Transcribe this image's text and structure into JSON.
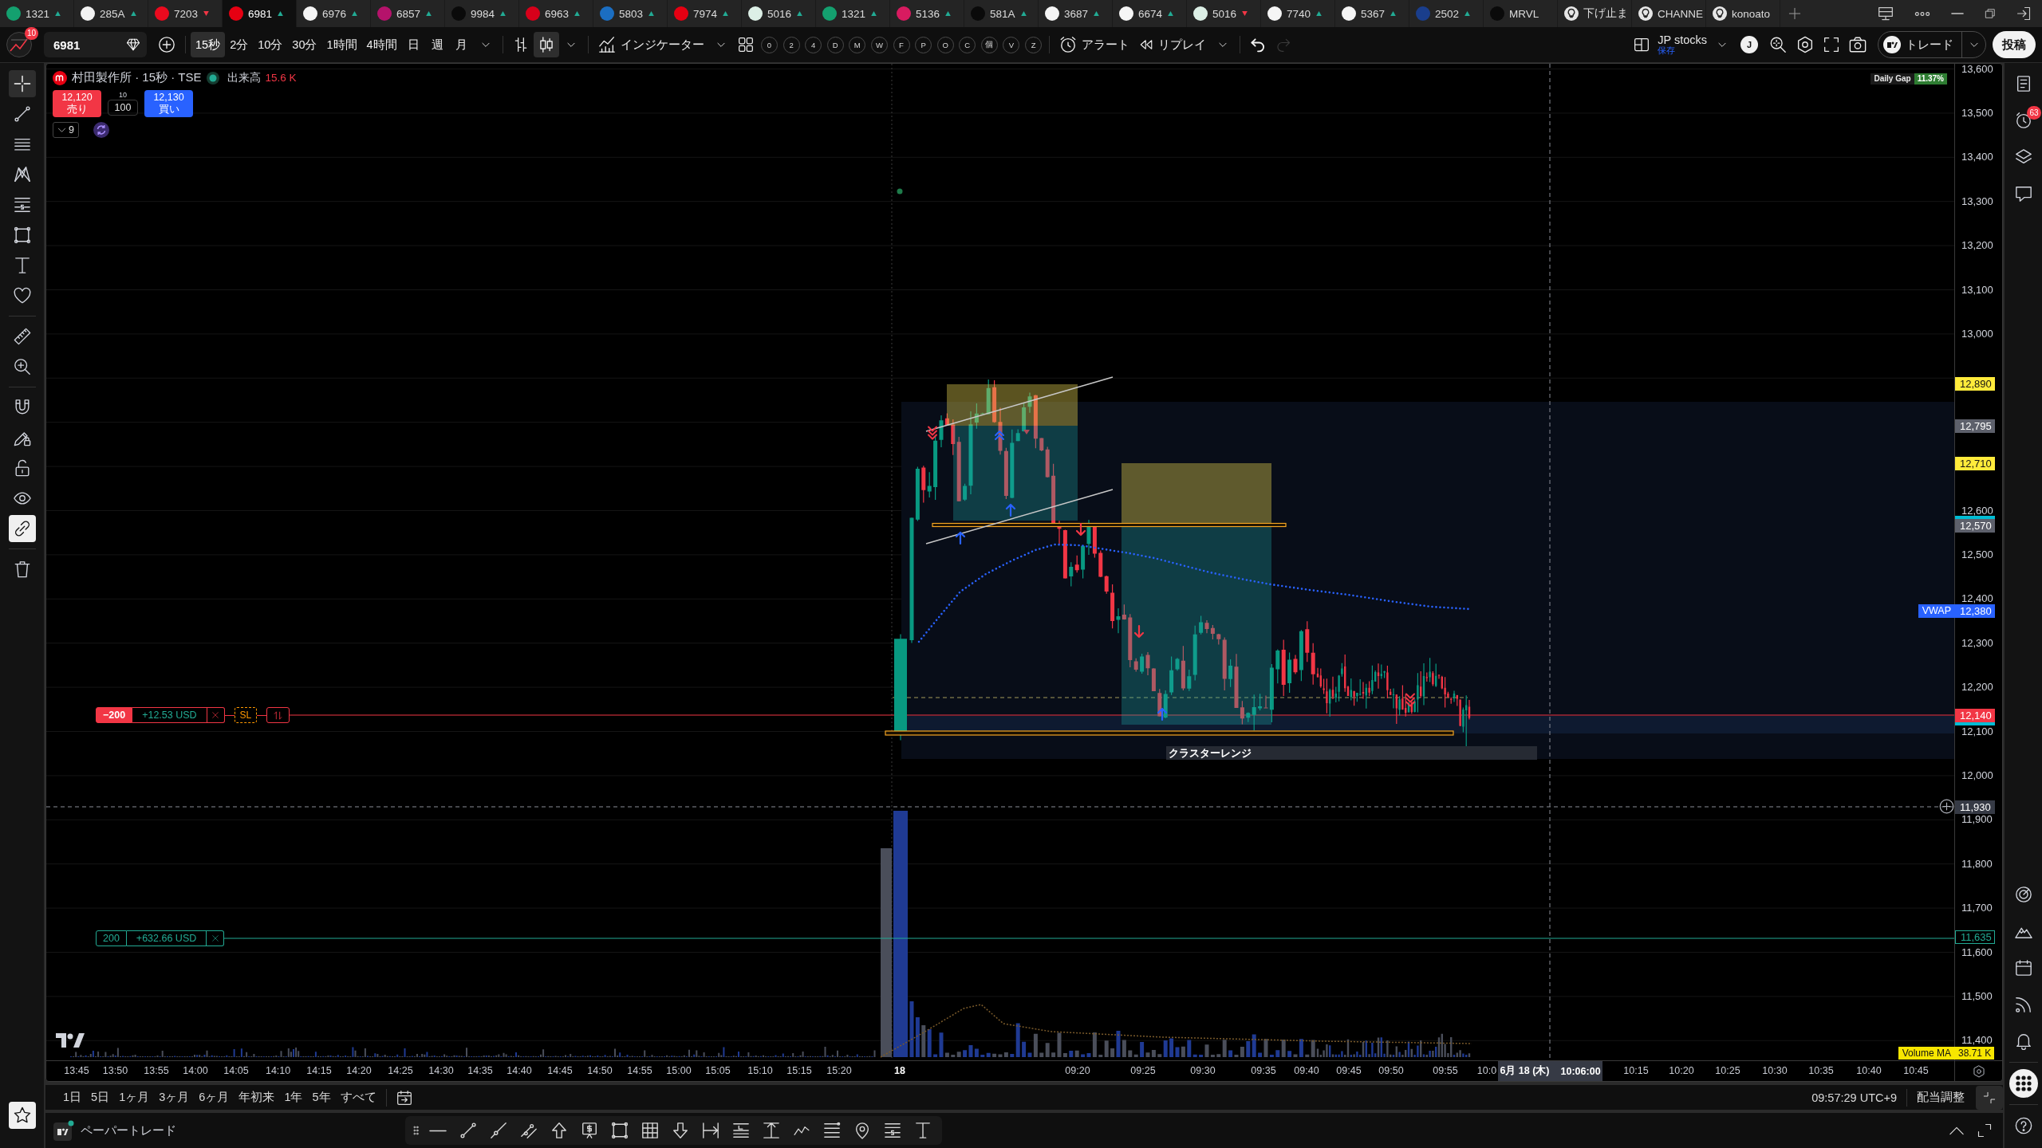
{
  "tabs": [
    {
      "kind": "symbol",
      "label": "1321",
      "up": true,
      "color": "#14a06f",
      "selected": false
    },
    {
      "kind": "symbol",
      "label": "285A",
      "up": true,
      "color": "#f2f2f2",
      "selected": false
    },
    {
      "kind": "symbol",
      "label": "7203",
      "up": false,
      "color": "#eb0a1e",
      "selected": false
    },
    {
      "kind": "symbol",
      "label": "6981",
      "up": true,
      "color": "#e60012",
      "selected": true
    },
    {
      "kind": "symbol",
      "label": "6976",
      "up": true,
      "color": "#f5f5f5",
      "selected": false
    },
    {
      "kind": "symbol",
      "label": "6857",
      "up": true,
      "color": "#b5136b",
      "selected": false
    },
    {
      "kind": "symbol",
      "label": "9984",
      "up": true,
      "color": "#0a0a0a",
      "selected": false
    },
    {
      "kind": "symbol",
      "label": "6963",
      "up": true,
      "color": "#d7001a",
      "selected": false
    },
    {
      "kind": "symbol",
      "label": "5803",
      "up": true,
      "color": "#1b6ec2",
      "selected": false
    },
    {
      "kind": "symbol",
      "label": "7974",
      "up": true,
      "color": "#e60012",
      "selected": false
    },
    {
      "kind": "symbol",
      "label": "5016",
      "up": true,
      "color": "#dcefe6",
      "selected": false
    },
    {
      "kind": "symbol",
      "label": "1321",
      "up": true,
      "color": "#14a06f",
      "selected": false
    },
    {
      "kind": "symbol",
      "label": "5136",
      "up": true,
      "color": "#d81b60",
      "selected": false
    },
    {
      "kind": "symbol",
      "label": "581A",
      "up": true,
      "color": "#0a0a0a",
      "selected": false
    },
    {
      "kind": "symbol",
      "label": "3687",
      "up": true,
      "color": "#f5f5f5",
      "selected": false
    },
    {
      "kind": "symbol",
      "label": "6674",
      "up": true,
      "color": "#f5f5f5",
      "selected": false
    },
    {
      "kind": "symbol",
      "label": "5016",
      "up": false,
      "color": "#dcefe6",
      "selected": false
    },
    {
      "kind": "symbol",
      "label": "7740",
      "up": true,
      "color": "#f5f5f5",
      "selected": false
    },
    {
      "kind": "symbol",
      "label": "5367",
      "up": true,
      "color": "#f5f5f5",
      "selected": false
    },
    {
      "kind": "symbol",
      "label": "2502",
      "up": true,
      "color": "#1a3e8c",
      "selected": false
    },
    {
      "kind": "symbol",
      "label": "MRVL",
      "color": "#0a0a0a",
      "selected": false
    },
    {
      "kind": "idea",
      "label": "下げ止ま",
      "selected": false
    },
    {
      "kind": "idea",
      "label": "CHANNE",
      "selected": false
    },
    {
      "kind": "idea",
      "label": "konoato",
      "selected": false
    }
  ],
  "toolbar": {
    "notification_count": "10",
    "symbol": "6981",
    "intervals": [
      {
        "label": "15秒",
        "selected": true
      },
      {
        "label": "2分",
        "selected": false
      },
      {
        "label": "10分",
        "selected": false
      },
      {
        "label": "30分",
        "selected": false
      },
      {
        "label": "1時間",
        "selected": false
      },
      {
        "label": "4時間",
        "selected": false
      },
      {
        "label": "日",
        "selected": false
      },
      {
        "label": "週",
        "selected": false
      },
      {
        "label": "月",
        "selected": false
      }
    ],
    "chart_styles": [
      {
        "kind": "bars",
        "selected": false
      },
      {
        "kind": "candles",
        "selected": true
      }
    ],
    "indicators_label": "インジケーター",
    "quick_buttons": [
      "0",
      "2",
      "4",
      "D",
      "M",
      "W",
      "F",
      "P",
      "O",
      "C",
      "個",
      "V",
      "Z"
    ],
    "alert_label": "アラート",
    "replay_label": "リプレイ",
    "history": [
      {
        "kind": "undo",
        "disabled": false
      },
      {
        "kind": "redo",
        "disabled": true
      }
    ],
    "layout_name": "JP stocks",
    "layout_status": "保存",
    "user_initial": "J",
    "trade_label": "トレード",
    "publish_label": "投稿"
  },
  "left_toolbar": [
    {
      "kind": "crosshair",
      "selected": true
    },
    {
      "kind": "trendline",
      "selected": false
    },
    {
      "kind": "fibonacci",
      "selected": false
    },
    {
      "kind": "pattern",
      "selected": false
    },
    {
      "kind": "forecast",
      "selected": false
    },
    {
      "kind": "shapes",
      "selected": false
    },
    {
      "kind": "text",
      "selected": false
    },
    {
      "kind": "favorites",
      "selected": false
    },
    {
      "kind": "measure",
      "selected": false
    },
    {
      "kind": "zoom",
      "selected": false
    },
    {
      "kind": "magnet",
      "selected": false
    },
    {
      "kind": "drawing-lock",
      "selected": false
    },
    {
      "kind": "lock",
      "selected": false
    },
    {
      "kind": "visibility",
      "selected": false
    },
    {
      "kind": "sync",
      "selected": true
    },
    {
      "kind": "remove",
      "selected": false
    }
  ],
  "chart": {
    "legend": {
      "title": "村田製作所 · 15秒 · TSE",
      "volume_label": "出来高",
      "volume_value": "15.6 K",
      "sell_price": "12,120",
      "sell_label": "売り",
      "spread": "10",
      "quantity": "100",
      "buy_price": "12,130",
      "buy_label": "買い",
      "collapsed_count": "9"
    },
    "daily_gap": {
      "label": "Daily Gap",
      "value": "11.37%"
    },
    "orders": [
      {
        "kind": "position",
        "quantity": "−200",
        "pnl": "+12.53 USD",
        "stop_label": "SL"
      },
      {
        "kind": "take_profit",
        "quantity": "200",
        "pnl": "+632.66 USD"
      }
    ],
    "drawing_label": "クラスターレンジ",
    "price_axis": {
      "ticks": [
        "13,600",
        "13,500",
        "13,400",
        "13,300",
        "13,200",
        "13,100",
        "13,000",
        "12,600",
        "12,500",
        "12,400",
        "12,300",
        "12,200",
        "12,100",
        "12,000",
        "11,900",
        "11,800",
        "11,700",
        "11,600",
        "11,500",
        "11,400"
      ],
      "markers": [
        {
          "kind": "filled",
          "label": "12,890",
          "color": "#ffeb3b"
        },
        {
          "kind": "filled",
          "label": "12,795",
          "color": "#5d606b"
        },
        {
          "kind": "filled",
          "label": "12,710",
          "color": "#ffeb3b"
        },
        {
          "kind": "edge",
          "color": "#00bcd4"
        },
        {
          "kind": "filled",
          "label": "12,570",
          "color": "#5d606b"
        },
        {
          "kind": "filled",
          "label": "12,380",
          "title": "VWAP",
          "color": "#2962ff"
        },
        {
          "kind": "filled",
          "label": "12,140",
          "color": "#f23645"
        },
        {
          "kind": "edge",
          "color": "#00bcd4"
        },
        {
          "kind": "outline",
          "label": "11,635",
          "color": "#22ab94"
        }
      ],
      "crosshair_price": "11,930",
      "volume_ma": {
        "label": "Volume MA",
        "value": "38.71 K"
      }
    },
    "time_axis": {
      "ticks": [
        {
          "kind": "time",
          "label": "13:45"
        },
        {
          "kind": "time",
          "label": "13:50"
        },
        {
          "kind": "time",
          "label": "13:55"
        },
        {
          "kind": "time",
          "label": "14:00"
        },
        {
          "kind": "time",
          "label": "14:05"
        },
        {
          "kind": "time",
          "label": "14:10"
        },
        {
          "kind": "time",
          "label": "14:15"
        },
        {
          "kind": "time",
          "label": "14:20"
        },
        {
          "kind": "time",
          "label": "14:25"
        },
        {
          "kind": "time",
          "label": "14:30"
        },
        {
          "kind": "time",
          "label": "14:35"
        },
        {
          "kind": "time",
          "label": "14:40"
        },
        {
          "kind": "time",
          "label": "14:45"
        },
        {
          "kind": "time",
          "label": "14:50"
        },
        {
          "kind": "time",
          "label": "14:55"
        },
        {
          "kind": "time",
          "label": "15:00"
        },
        {
          "kind": "time",
          "label": "15:05"
        },
        {
          "kind": "time",
          "label": "15:10"
        },
        {
          "kind": "time",
          "label": "15:15"
        },
        {
          "kind": "time",
          "label": "15:20"
        },
        {
          "kind": "day",
          "label": "18"
        },
        {
          "kind": "time",
          "label": "09:20"
        },
        {
          "kind": "time",
          "label": "09:25"
        },
        {
          "kind": "time",
          "label": "09:30"
        },
        {
          "kind": "time",
          "label": "09:35"
        },
        {
          "kind": "time",
          "label": "09:40"
        },
        {
          "kind": "time",
          "label": "09:45"
        },
        {
          "kind": "time",
          "label": "09:50"
        },
        {
          "kind": "time",
          "label": "09:55"
        },
        {
          "kind": "time",
          "label": "10:0"
        },
        {
          "kind": "time",
          "label": "10:15"
        },
        {
          "kind": "time",
          "label": "10:20"
        },
        {
          "kind": "time",
          "label": "10:25"
        },
        {
          "kind": "time",
          "label": "10:30"
        },
        {
          "kind": "time",
          "label": "10:35"
        },
        {
          "kind": "time",
          "label": "10:40"
        },
        {
          "kind": "time",
          "label": "10:45"
        }
      ],
      "crosshair_date": "6月 18 (木)",
      "crosshair_time": "10:06:00"
    }
  },
  "range_bar": {
    "ranges": [
      "1日",
      "5日",
      "1ヶ月",
      "3ヶ月",
      "6ヶ月",
      "年初来",
      "1年",
      "5年",
      "すべて"
    ],
    "clock": "09:57:29 UTC+9",
    "adjustment_label": "配当調整"
  },
  "bottom_bar": {
    "panel_title": "ペーパートレード"
  },
  "right_sidebar": {
    "alerts_badge": "63"
  }
}
